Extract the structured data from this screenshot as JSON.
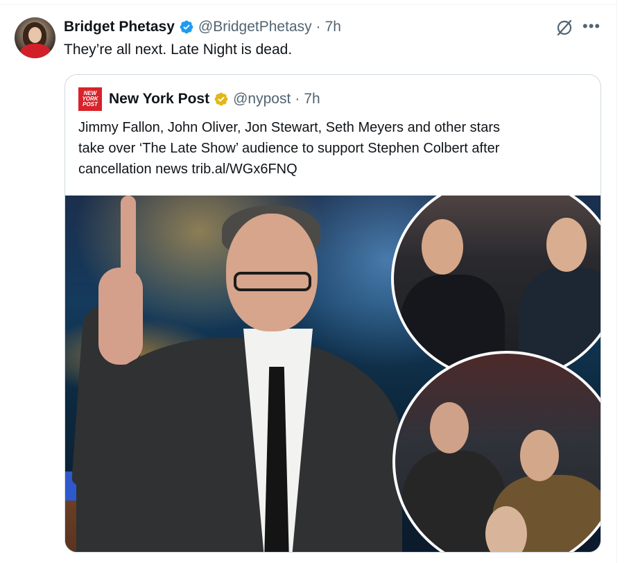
{
  "tweet": {
    "author": {
      "display_name": "Bridget Phetasy",
      "handle": "@BridgetPhetasy",
      "separator": "·",
      "time": "7h",
      "verified": true,
      "badge_color": "#1d9bf0"
    },
    "text": "They’re all next. Late Night is dead.",
    "actions": {
      "grok_icon": "grok-icon",
      "more_icon": "more-icon"
    }
  },
  "quote": {
    "author": {
      "logo_text": [
        "NEW",
        "YORK",
        "POST"
      ],
      "display_name": "New York Post",
      "handle": "@nypost",
      "separator": "·",
      "time": "7h",
      "verified": true,
      "badge_color": "#e2b719",
      "logo_color": "#d9222a"
    },
    "text_lines": [
      "Jimmy Fallon, John Oliver, Jon Stewart, Seth Meyers and other stars",
      "take over ‘The Late Show’ audience to support Stephen Colbert after",
      "cancellation news trib.al/WGx6FNQ"
    ],
    "media": {
      "description_icon": "photo"
    }
  }
}
